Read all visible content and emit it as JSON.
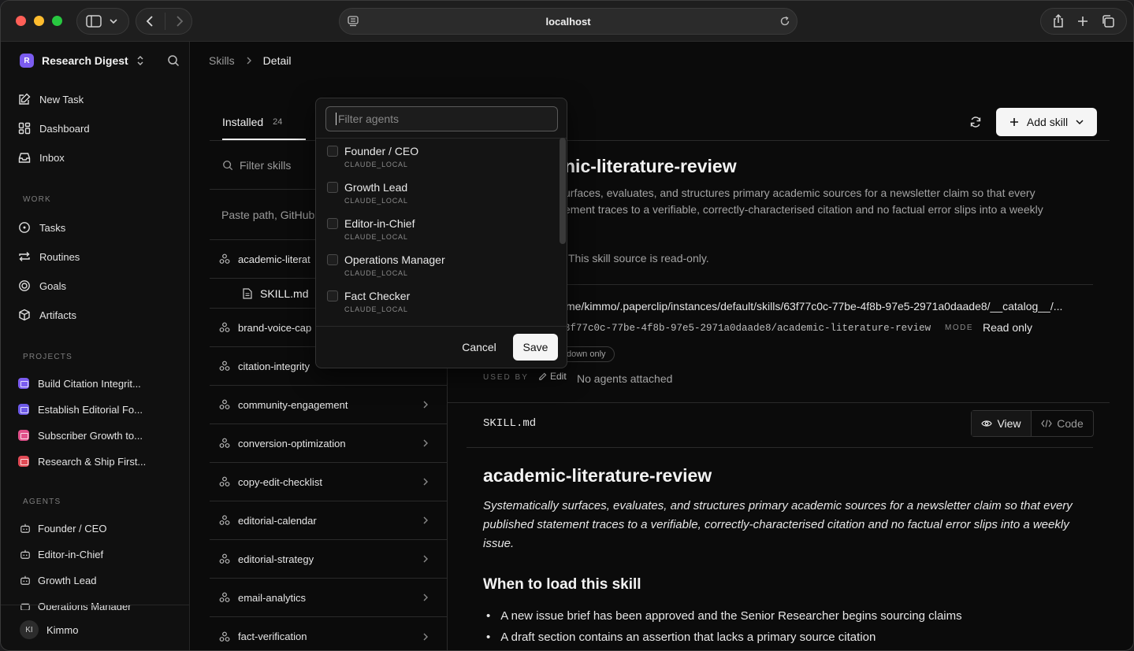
{
  "browser": {
    "address": "localhost"
  },
  "sidebar": {
    "workspace": "Research Digest",
    "workspace_initial": "R",
    "nav": [
      {
        "label": "New Task",
        "icon": "edit-icon"
      },
      {
        "label": "Dashboard",
        "icon": "dashboard-icon"
      },
      {
        "label": "Inbox",
        "icon": "inbox-icon"
      }
    ],
    "work_title": "WORK",
    "work": [
      {
        "label": "Tasks",
        "icon": "circle-dot-icon"
      },
      {
        "label": "Routines",
        "icon": "repeat-icon"
      },
      {
        "label": "Goals",
        "icon": "target-icon"
      },
      {
        "label": "Artifacts",
        "icon": "box-icon"
      }
    ],
    "projects_title": "PROJECTS",
    "projects": [
      {
        "label": "Build Citation Integrit...",
        "color": "#7b5cf0"
      },
      {
        "label": "Establish Editorial Fo...",
        "color": "#6d5ae8"
      },
      {
        "label": "Subscriber Growth to...",
        "color": "#e0508a"
      },
      {
        "label": "Research & Ship First...",
        "color": "#e04a55"
      }
    ],
    "agents_title": "AGENTS",
    "agents": [
      "Founder / CEO",
      "Editor-in-Chief",
      "Growth Lead",
      "Operations Manager"
    ],
    "user": {
      "initials": "KI",
      "name": "Kimmo"
    }
  },
  "breadcrumb": {
    "parent": "Skills",
    "current": "Detail"
  },
  "tabs": {
    "installed_label": "Installed",
    "installed_count": "24"
  },
  "filter_skills_placeholder": "Filter skills",
  "paste_path_placeholder": "Paste path, GitHub",
  "skills": [
    {
      "name": "academic-literat",
      "expanded": true
    },
    {
      "name": "SKILL.md",
      "file": true
    },
    {
      "name": "brand-voice-cap"
    },
    {
      "name": "citation-integrity"
    },
    {
      "name": "community-engagement"
    },
    {
      "name": "conversion-optimization"
    },
    {
      "name": "copy-edit-checklist"
    },
    {
      "name": "editorial-calendar"
    },
    {
      "name": "editorial-strategy"
    },
    {
      "name": "email-analytics"
    },
    {
      "name": "fact-verification"
    }
  ],
  "detail": {
    "add_skill_label": "Add skill",
    "title_partial": "nic-literature-review",
    "desc_line1": "urfaces, evaluates, and structures primary academic sources for a newsletter claim so that every",
    "desc_line2": "ement traces to a verifiable, correctly-characterised citation and no factual error slips into a weekly",
    "readonly_note": "This skill source is read-only.",
    "path": "me/kimmo/.paperclip/instances/default/skills/63f77c0c-77be-4f8b-97e5-2971a0daade8/__catalog__/...",
    "key": "3f77c0c-77be-4f8b-97e5-2971a0daade8/academic-literature-review",
    "mode_label": "MODE",
    "mode_value": "Read only",
    "badge": "down only",
    "used_by_label": "USED BY",
    "edit_label": "Edit",
    "no_agents": "No agents attached",
    "file_name": "SKILL.md",
    "view_label": "View",
    "code_label": "Code",
    "md_title": "academic-literature-review",
    "md_intro": "Systematically surfaces, evaluates, and structures primary academic sources for a newsletter claim so that every published statement traces to a verifiable, correctly-characterised citation and no factual error slips into a weekly issue.",
    "md_section": "When to load this skill",
    "md_bullets": [
      "A new issue brief has been approved and the Senior Researcher begins sourcing claims",
      "A draft section contains an assertion that lacks a primary source citation"
    ]
  },
  "popup": {
    "filter_placeholder": "Filter agents",
    "agents": [
      {
        "name": "Founder / CEO",
        "adapter": "CLAUDE_LOCAL"
      },
      {
        "name": "Growth Lead",
        "adapter": "CLAUDE_LOCAL"
      },
      {
        "name": "Editor-in-Chief",
        "adapter": "CLAUDE_LOCAL"
      },
      {
        "name": "Operations Manager",
        "adapter": "CLAUDE_LOCAL"
      },
      {
        "name": "Fact Checker",
        "adapter": "CLAUDE_LOCAL"
      }
    ],
    "cancel_label": "Cancel",
    "save_label": "Save"
  }
}
